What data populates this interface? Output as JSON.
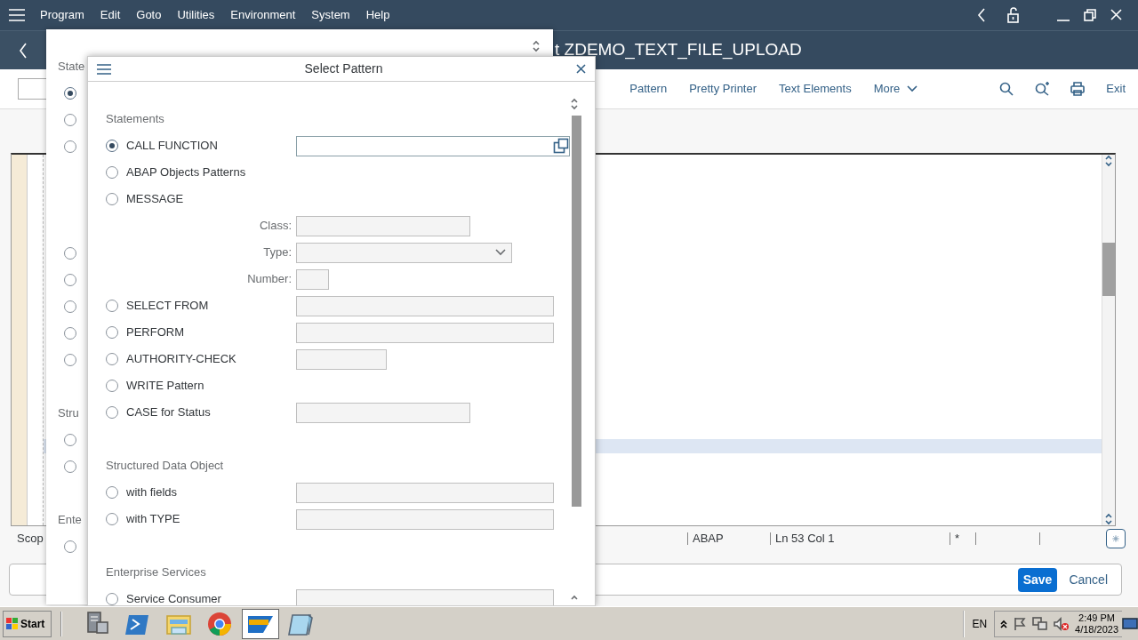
{
  "menu_bar": {
    "items": [
      "Program",
      "Edit",
      "Goto",
      "Utilities",
      "Environment",
      "System",
      "Help"
    ]
  },
  "title_bar": {
    "title": "t ZDEMO_TEXT_FILE_UPLOAD"
  },
  "toolbar": {
    "buttons": [
      "Pattern",
      "Pretty Printer",
      "Text Elements",
      "More"
    ],
    "exit": "Exit"
  },
  "status_bar": {
    "scope": "Scop",
    "language": "ABAP",
    "position": "Ln 53 Col 1",
    "modified": "*"
  },
  "footer": {
    "save": "Save",
    "cancel": "Cancel"
  },
  "background_dialog": {
    "items": [
      {
        "kind": "heading",
        "text": "State"
      },
      {
        "kind": "radio",
        "selected": true
      },
      {
        "kind": "radio",
        "selected": false
      },
      {
        "kind": "radio",
        "selected": false
      },
      {
        "kind": "radio",
        "selected": false
      },
      {
        "kind": "radio",
        "selected": false
      },
      {
        "kind": "radio",
        "selected": false
      },
      {
        "kind": "radio",
        "selected": false
      },
      {
        "kind": "radio",
        "selected": false
      },
      {
        "kind": "heading",
        "text": "Stru"
      },
      {
        "kind": "radio",
        "selected": false
      },
      {
        "kind": "radio",
        "selected": false
      },
      {
        "kind": "heading",
        "text": "Ente"
      },
      {
        "kind": "radio",
        "selected": false
      }
    ]
  },
  "dialog": {
    "title": "Select Pattern",
    "items": [
      {
        "kind": "heading",
        "text": "Statements"
      },
      {
        "kind": "option",
        "label": "CALL FUNCTION",
        "selected": true,
        "field": {
          "kind": "value_help",
          "disabled": false
        }
      },
      {
        "kind": "option",
        "label": "ABAP Objects Patterns",
        "selected": false
      },
      {
        "kind": "option",
        "label": "MESSAGE",
        "selected": false
      },
      {
        "kind": "field",
        "label": "Class:",
        "field": {
          "kind": "text",
          "disabled": true
        }
      },
      {
        "kind": "field",
        "label": "Type:",
        "field": {
          "kind": "dropdown",
          "disabled": true
        }
      },
      {
        "kind": "field",
        "label": "Number:",
        "field": {
          "kind": "text",
          "disabled": true
        }
      },
      {
        "kind": "option",
        "label": "SELECT FROM",
        "selected": false,
        "field": {
          "kind": "text",
          "disabled": true
        }
      },
      {
        "kind": "option",
        "label": "PERFORM",
        "selected": false,
        "field": {
          "kind": "text",
          "disabled": true
        }
      },
      {
        "kind": "option",
        "label": "AUTHORITY-CHECK",
        "selected": false,
        "field": {
          "kind": "text",
          "disabled": true
        }
      },
      {
        "kind": "option",
        "label": "WRITE Pattern",
        "selected": false
      },
      {
        "kind": "option",
        "label": "CASE for Status",
        "selected": false,
        "field": {
          "kind": "text",
          "disabled": true
        }
      },
      {
        "kind": "heading",
        "text": "Structured Data Object"
      },
      {
        "kind": "option",
        "label": "with fields",
        "selected": false,
        "field": {
          "kind": "text",
          "disabled": true
        }
      },
      {
        "kind": "option",
        "label": "with TYPE",
        "selected": false,
        "field": {
          "kind": "text",
          "disabled": true
        }
      },
      {
        "kind": "heading",
        "text": "Enterprise Services"
      },
      {
        "kind": "option",
        "label": "Service Consumer",
        "selected": false,
        "field": {
          "kind": "text",
          "disabled": true
        }
      }
    ]
  },
  "taskbar": {
    "start": "Start",
    "apps": [
      {
        "kind": "server",
        "selected": false
      },
      {
        "kind": "terminal",
        "selected": false
      },
      {
        "kind": "folder",
        "selected": false
      },
      {
        "kind": "browser",
        "selected": false
      },
      {
        "kind": "sap",
        "selected": true
      },
      {
        "kind": "notepad",
        "selected": false
      }
    ],
    "language": "EN",
    "time": "2:49 PM",
    "date": "4/18/2023"
  }
}
